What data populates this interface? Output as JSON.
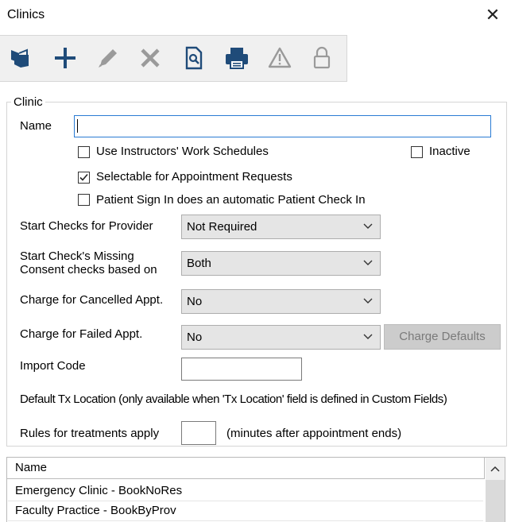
{
  "window": {
    "title": "Clinics",
    "close_symbol": "✕"
  },
  "clinic_group": {
    "title": "Clinic",
    "name_label": "Name",
    "name_value": "",
    "use_instructors": {
      "label": "Use Instructors' Work Schedules",
      "checked": false
    },
    "inactive": {
      "label": "Inactive",
      "checked": false
    },
    "selectable": {
      "label": "Selectable for Appointment Requests",
      "checked": true
    },
    "patient_sign_in": {
      "label": "Patient Sign In does an automatic Patient Check In",
      "checked": false
    },
    "start_checks": {
      "label": "Start Checks for Provider",
      "value": "Not Required"
    },
    "missing_consent": {
      "label_line1": "Start Check's Missing",
      "label_line2": "Consent checks based on",
      "value": "Both"
    },
    "charge_cancelled": {
      "label": "Charge for Cancelled Appt.",
      "value": "No"
    },
    "charge_failed": {
      "label": "Charge for Failed Appt.",
      "value": "No"
    },
    "charge_defaults_label": "Charge Defaults",
    "import_code_label": "Import Code",
    "import_code_value": "",
    "default_tx_location_label": "Default Tx Location (only available when 'Tx Location' field is defined in Custom Fields)",
    "rules_label": "Rules for treatments apply",
    "rules_value": "",
    "rules_suffix": "(minutes after appointment ends)"
  },
  "list": {
    "header": "Name",
    "rows": [
      "Emergency Clinic - BookNoRes",
      "Faculty Practice - BookByProv"
    ]
  },
  "icons": {
    "open": "open-folder-icon",
    "add": "plus-icon",
    "edit": "pencil-icon",
    "delete": "x-delete-icon",
    "preview": "preview-icon",
    "print": "printer-icon",
    "warning": "warning-icon",
    "lock": "lock-icon"
  },
  "colors": {
    "accent": "#2a7bd4",
    "toolbar_icon": "#1f4b79",
    "disabled_icon": "#9a9a9a"
  }
}
